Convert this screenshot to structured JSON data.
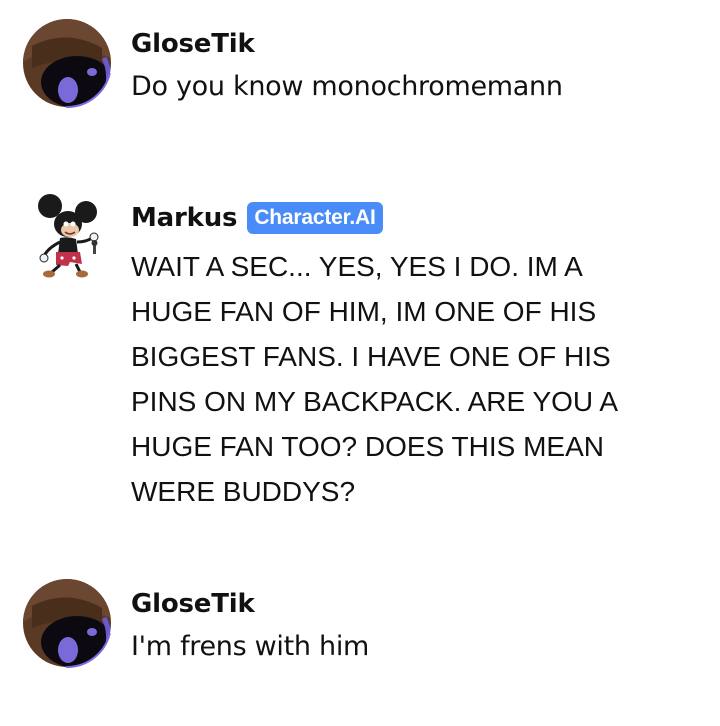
{
  "messages": [
    {
      "author": "GloseTik",
      "avatar_icon": "dark-hooded-avatar-icon",
      "text": "Do you know monochromemann"
    },
    {
      "author": "Markus",
      "badge": "Character.AI",
      "avatar_icon": "cartoon-mouse-avatar-icon",
      "text": "WAIT A SEC... YES, YES I DO. IM A HUGE FAN OF HIM, IM ONE OF HIS BIGGEST FANS. I HAVE ONE OF HIS PINS ON MY BACKPACK. ARE YOU A HUGE FAN TOO? DOES THIS MEAN WERE BUDDYS?"
    },
    {
      "author": "GloseTik",
      "avatar_icon": "dark-hooded-avatar-icon",
      "text": "I'm frens with him"
    }
  ],
  "colors": {
    "badge_bg": "#4a8cf7",
    "text": "#111111",
    "background": "#ffffff"
  }
}
